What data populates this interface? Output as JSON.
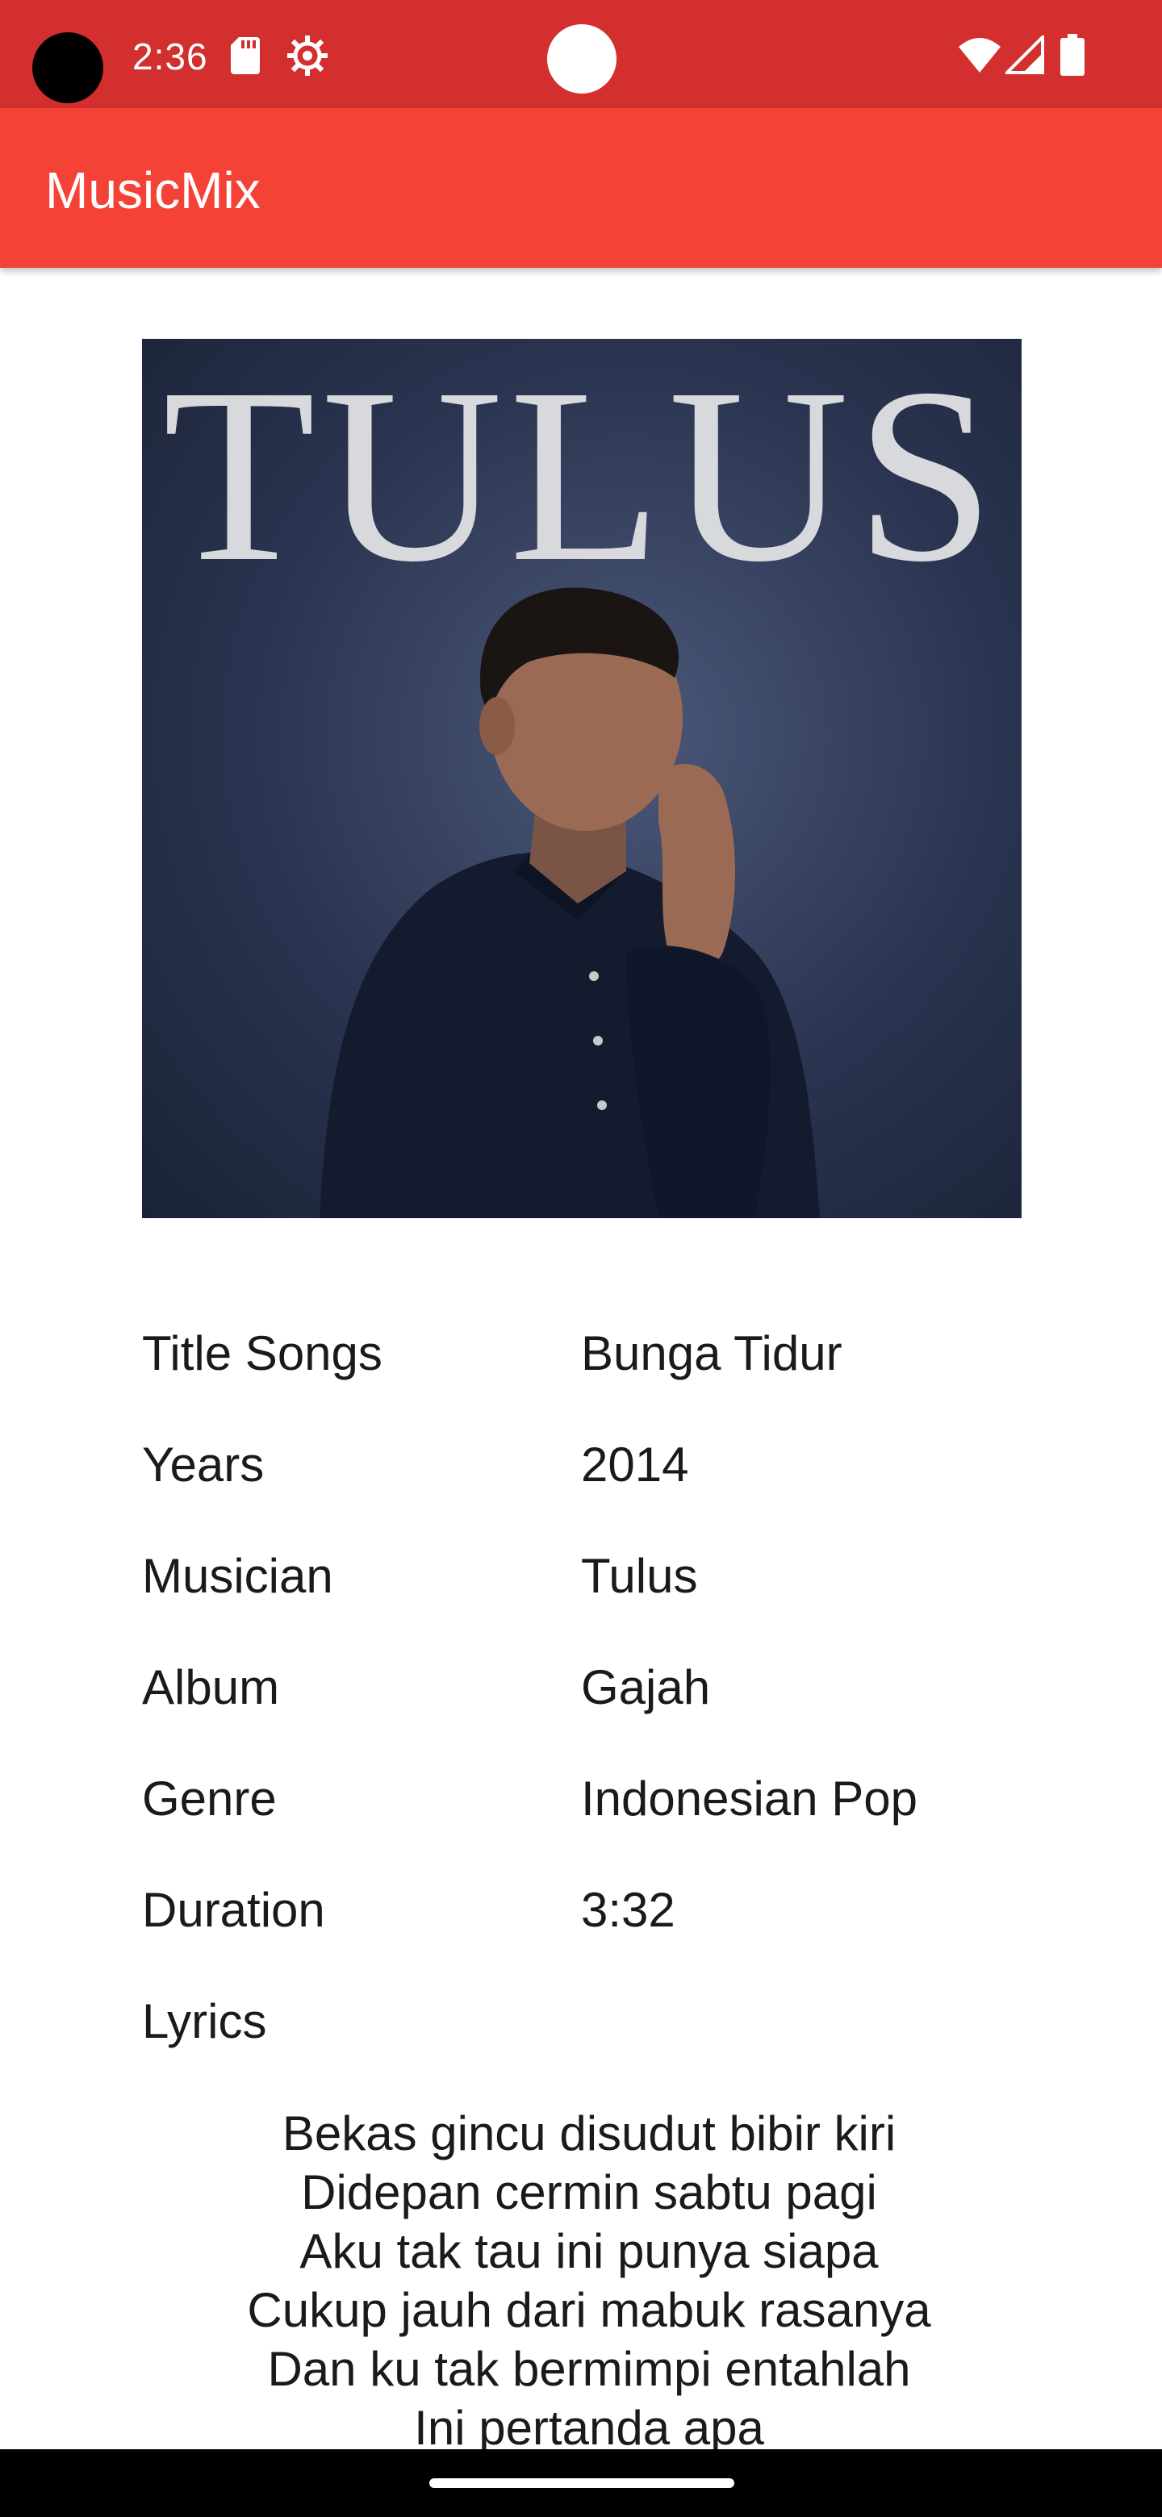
{
  "status_bar": {
    "time": "2:36",
    "color": "#d32f2f"
  },
  "app_bar": {
    "title": "MusicMix",
    "color": "#f44336"
  },
  "cover": {
    "text": "TULUS"
  },
  "details": [
    {
      "label": "Title Songs",
      "value": "Bunga Tidur"
    },
    {
      "label": "Years",
      "value": "2014"
    },
    {
      "label": "Musician",
      "value": "Tulus"
    },
    {
      "label": "Album",
      "value": "Gajah"
    },
    {
      "label": "Genre",
      "value": "Indonesian Pop"
    },
    {
      "label": "Duration",
      "value": "3:32"
    }
  ],
  "lyrics_label": "Lyrics",
  "lyrics": [
    "Bekas gincu disudut bibir kiri",
    "Didepan cermin sabtu pagi",
    "Aku tak tau ini punya siapa",
    "Cukup jauh dari mabuk rasanya",
    "Dan ku tak bermimpi entahlah",
    "Ini pertanda apa"
  ],
  "icons": [
    "sd-card-icon",
    "settings-icon",
    "wifi-icon",
    "signal-icon",
    "battery-icon"
  ]
}
